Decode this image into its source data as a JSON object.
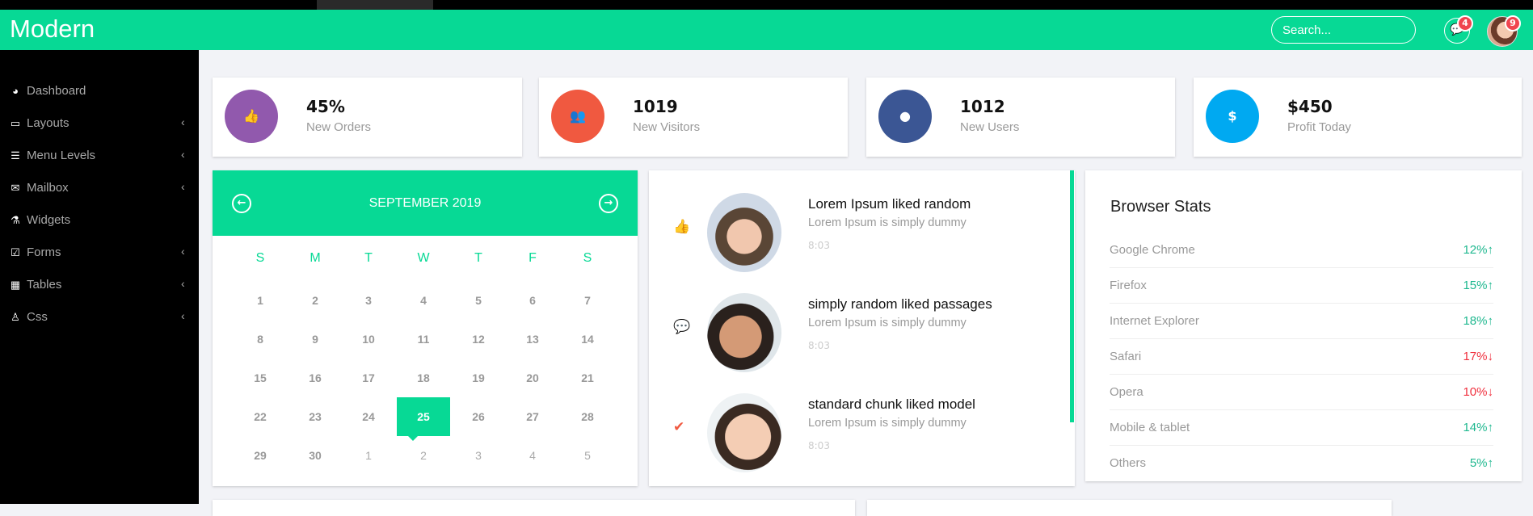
{
  "app": {
    "title": "Modern"
  },
  "header": {
    "search_placeholder": "Search...",
    "messages_count": "4",
    "profile_count": "9",
    "messages_icon": "comments-icon"
  },
  "sidebar": {
    "items": [
      {
        "label": "Dashboard",
        "icon": "dashboard-icon",
        "glyph": "◕",
        "submenu": false
      },
      {
        "label": "Layouts",
        "icon": "laptop-icon",
        "glyph": "▭",
        "submenu": true
      },
      {
        "label": "Menu Levels",
        "icon": "indent-icon",
        "glyph": "☰",
        "submenu": true
      },
      {
        "label": "Mailbox",
        "icon": "envelope-icon",
        "glyph": "✉",
        "submenu": true
      },
      {
        "label": "Widgets",
        "icon": "flask-icon",
        "glyph": "⚗",
        "submenu": false
      },
      {
        "label": "Forms",
        "icon": "check-square-icon",
        "glyph": "☑",
        "submenu": true
      },
      {
        "label": "Tables",
        "icon": "table-icon",
        "glyph": "▦",
        "submenu": true
      },
      {
        "label": "Css",
        "icon": "sitemap-icon",
        "glyph": "♙",
        "submenu": true
      }
    ],
    "chevron": "‹"
  },
  "stats": [
    {
      "value": "45%",
      "label": "New Orders",
      "icon": "thumbs-up-icon",
      "glyph": "👍",
      "color": "#9159ad"
    },
    {
      "value": "1019",
      "label": "New Visitors",
      "icon": "users-icon",
      "glyph": "👥",
      "color": "#f05940"
    },
    {
      "value": "1012",
      "label": "New Users",
      "icon": "comment-icon",
      "glyph": "●",
      "color": "#3b5694"
    },
    {
      "value": "$450",
      "label": "Profit Today",
      "icon": "dollar-icon",
      "glyph": "$",
      "color": "#00a9f1"
    }
  ],
  "calendar": {
    "title": "SEPTEMBER 2019",
    "prev": "←",
    "next": "→",
    "weekdays": [
      "S",
      "M",
      "T",
      "W",
      "T",
      "F",
      "S"
    ],
    "weeks": [
      [
        "1",
        "2",
        "3",
        "4",
        "5",
        "6",
        "7"
      ],
      [
        "8",
        "9",
        "10",
        "11",
        "12",
        "13",
        "14"
      ],
      [
        "15",
        "16",
        "17",
        "18",
        "19",
        "20",
        "21"
      ],
      [
        "22",
        "23",
        "24",
        "25",
        "26",
        "27",
        "28"
      ],
      [
        "29",
        "30",
        "1",
        "2",
        "3",
        "4",
        "5"
      ]
    ],
    "selected": "25"
  },
  "feed": [
    {
      "title": "Lorem Ipsum liked random",
      "text": "Lorem Ipsum is simply dummy",
      "time": "8:03",
      "icon": "thumbs-up-icon",
      "glyph": "👍",
      "icon_color": "#1e9ff2"
    },
    {
      "title": "simply random liked passages",
      "text": "Lorem Ipsum is simply dummy",
      "time": "8:03",
      "icon": "comment-icon",
      "glyph": "💬",
      "icon_color": "#2f7197"
    },
    {
      "title": "standard chunk liked model",
      "text": "Lorem Ipsum is simply dummy",
      "time": "8:03",
      "icon": "check-icon",
      "glyph": "✔",
      "icon_color": "#f05940"
    }
  ],
  "browser_stats": {
    "title": "Browser Stats",
    "rows": [
      {
        "name": "Google Chrome",
        "value": "12%",
        "trend": "up"
      },
      {
        "name": "Firefox",
        "value": "15%",
        "trend": "up"
      },
      {
        "name": "Internet Explorer",
        "value": "18%",
        "trend": "up"
      },
      {
        "name": "Safari",
        "value": "17%",
        "trend": "down"
      },
      {
        "name": "Opera",
        "value": "10%",
        "trend": "down"
      },
      {
        "name": "Mobile & tablet",
        "value": "14%",
        "trend": "up"
      },
      {
        "name": "Others",
        "value": "5%",
        "trend": "up"
      }
    ],
    "up_color": "#1fb88f",
    "down_color": "#f0303e"
  },
  "colors": {
    "accent": "#07d995",
    "sidebar": "#000000",
    "background": "#f2f3f7"
  }
}
